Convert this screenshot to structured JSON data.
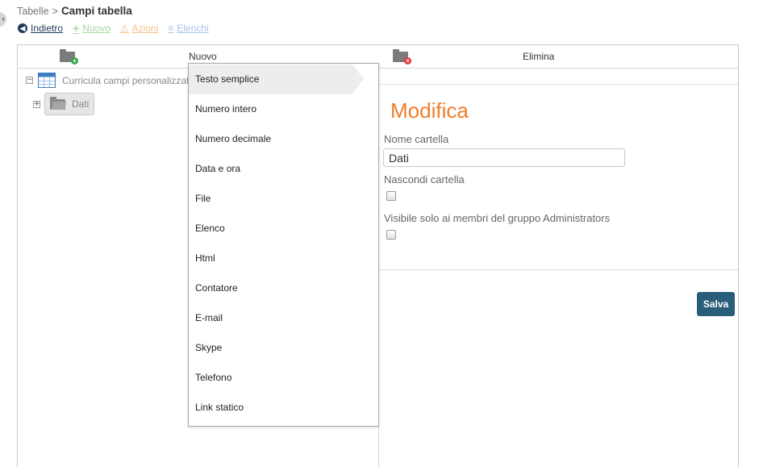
{
  "breadcrumb": {
    "parent": "Tabelle",
    "separator": ">",
    "current": "Campi tabella"
  },
  "actions": {
    "back": "Indietro",
    "new": "Nuovo",
    "actions": "Azioni",
    "lists": "Elenchi"
  },
  "toolbar": {
    "new_label": "Nuovo",
    "delete_label": "Elimina"
  },
  "tree": {
    "root_label": "Curricula campi personalizzati",
    "child_label": "Dati",
    "root_expander": "−",
    "child_expander": "+"
  },
  "form": {
    "title": "Modifica",
    "folder_name_label": "Nome cartella",
    "folder_name_value": "Dati",
    "hide_folder_label": "Nascondi cartella",
    "admin_only_label": "Visibile solo ai membri del gruppo Administrators",
    "save_label": "Salva"
  },
  "menu": {
    "items": [
      "Testo semplice",
      "Numero intero",
      "Numero decimale",
      "Data e ora",
      "File",
      "Elenco",
      "Html",
      "Contatore",
      "E-mail",
      "Skype",
      "Telefono",
      "Link statico"
    ],
    "active_index": 0
  },
  "colors": {
    "accent_title": "#f07c2a",
    "save_button": "#2a5d7a",
    "new_action": "#a8d8a8",
    "actions_action": "#f4c38a",
    "lists_action": "#a9c3e6"
  }
}
